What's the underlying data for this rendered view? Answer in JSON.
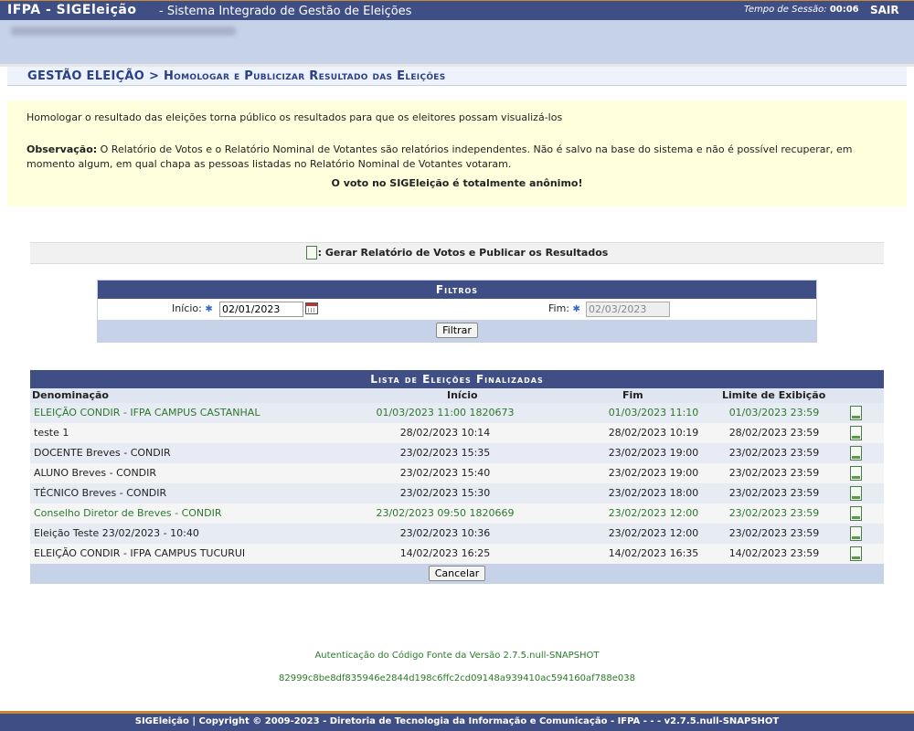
{
  "header": {
    "brand": "IFPA - SIGEleição",
    "subtitle": "- Sistema Integrado de Gestão de Eleições",
    "session_label": "Tempo de Sessão:",
    "session_time": "00:06",
    "logout": "SAIR"
  },
  "breadcrumb": "GESTÃO ELEIÇÃO > Homologar e Publicizar Resultado das Eleições",
  "info": {
    "line1": "Homologar o resultado das eleições torna público os resultados para que os eleitores possam visualizá-los",
    "obs_label": "Observação:",
    "obs_text": " O Relatório de Votos e o Relatório Nominal de Votantes são relatórios independentes. Não é salvo na base do sistema e não é possível recuperar, em momento algum, em qual chapa as pessoas listadas no Relatório Nominal de Votantes votaram.",
    "anon": "O voto no SIGEleição é totalmente anônimo!"
  },
  "report_link": ": Gerar Relatório de Votos e Publicar os Resultados",
  "filters": {
    "title": "Filtros",
    "start_label": "Início:",
    "start_value": "02/01/2023",
    "end_label": "Fim:",
    "end_value": "02/03/2023",
    "button": "Filtrar"
  },
  "list": {
    "title": "Lista de Eleições Finalizadas",
    "columns": [
      "Denominação",
      "Início",
      "Fim",
      "Limite de Exibição"
    ],
    "rows": [
      {
        "name": "ELEIÇÃO CONDIR - IFPA CAMPUS CASTANHAL",
        "start": "01/03/2023 11:00 1820673",
        "end": "01/03/2023 11:10",
        "limit": "01/03/2023 23:59"
      },
      {
        "name": "teste 1",
        "start": "28/02/2023 10:14",
        "end": "28/02/2023 10:19",
        "limit": "28/02/2023 23:59"
      },
      {
        "name": "DOCENTE Breves - CONDIR",
        "start": "23/02/2023 15:35",
        "end": "23/02/2023 19:00",
        "limit": "23/02/2023 23:59"
      },
      {
        "name": "ALUNO Breves - CONDIR",
        "start": "23/02/2023 15:40",
        "end": "23/02/2023 19:00",
        "limit": "23/02/2023 23:59"
      },
      {
        "name": "TÉCNICO Breves - CONDIR",
        "start": "23/02/2023 15:30",
        "end": "23/02/2023 18:00",
        "limit": "23/02/2023 23:59"
      },
      {
        "name": "Conselho Diretor de Breves - CONDIR",
        "start": "23/02/2023 09:50 1820669",
        "end": "23/02/2023 12:00",
        "limit": "23/02/2023 23:59"
      },
      {
        "name": "Eleição Teste 23/02/2023 - 10:40",
        "start": "23/02/2023 10:36",
        "end": "23/02/2023 12:00",
        "limit": "23/02/2023 23:59"
      },
      {
        "name": "ELEIÇÃO CONDIR - IFPA CAMPUS TUCURUI",
        "start": "14/02/2023 16:25",
        "end": "14/02/2023 16:35",
        "limit": "14/02/2023 23:59"
      }
    ],
    "cancel": "Cancelar"
  },
  "auth": {
    "line1": "Autenticação do Código Fonte da Versão 2.7.5.null-SNAPSHOT",
    "line2": "82999c8be8df835946e2844d198c6ffc2cd09148a939410ac594160af788e038"
  },
  "footer": "SIGEleição | Copyright © 2009-2023 - Diretoria de Tecnologia da Informação e Comunicação - IFPA - - - v2.7.5.null-SNAPSHOT",
  "colors": {
    "header": "#3f4f86",
    "accent": "#cc8a2e",
    "highlight_text": "#2a7a2a",
    "info_bg": "#ffffdd"
  },
  "icons": {
    "report": "document-icon",
    "calendar": "calendar-icon",
    "row_action": "document-icon"
  }
}
